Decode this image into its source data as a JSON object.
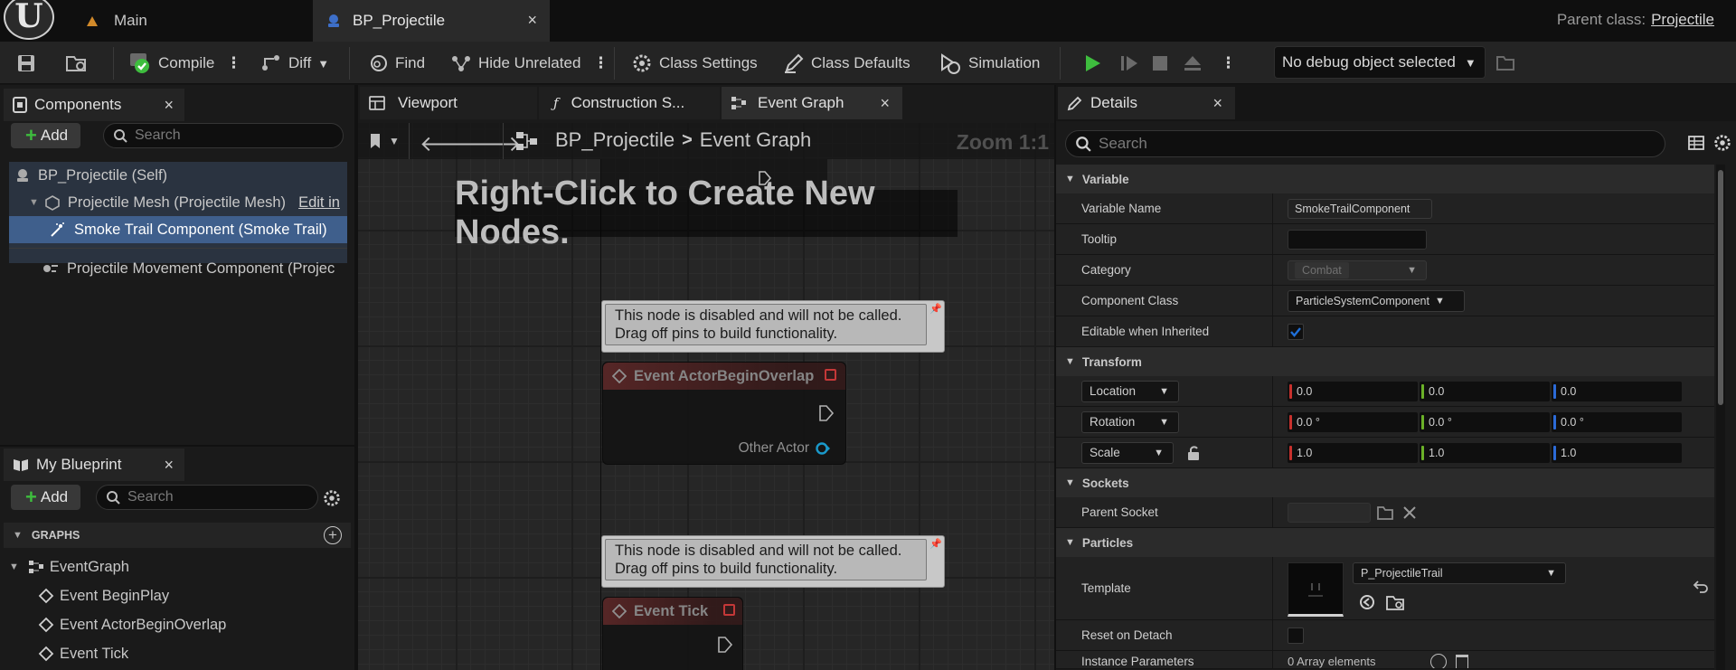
{
  "titlebar": {
    "logo": "U",
    "tabs": [
      {
        "label": "Main",
        "icon": "map-icon"
      },
      {
        "label": "BP_Projectile",
        "icon": "blueprint-icon",
        "close": "×"
      }
    ],
    "parent_class_label": "Parent class:",
    "parent_class_value": "Projectile"
  },
  "toolbar": {
    "compile": "Compile",
    "diff": "Diff",
    "find": "Find",
    "hide_unrelated": "Hide Unrelated",
    "class_settings": "Class Settings",
    "class_defaults": "Class Defaults",
    "simulation": "Simulation",
    "debug_object": "No debug object selected"
  },
  "components": {
    "tab_label": "Components",
    "close": "×",
    "add_label": "Add",
    "search_placeholder": "Search",
    "items": [
      {
        "label": "BP_Projectile (Self)"
      },
      {
        "label": "Projectile Mesh (Projectile Mesh)",
        "extra": "Edit in"
      },
      {
        "label": "Smoke Trail Component (Smoke Trail)"
      },
      {
        "label": "Projectile Movement Component (Projec"
      }
    ]
  },
  "my_blueprint": {
    "tab_label": "My Blueprint",
    "close": "×",
    "add_label": "Add",
    "search_placeholder": "Search",
    "graphs_header": "GRAPHS",
    "graph_name": "EventGraph",
    "events": [
      "Event BeginPlay",
      "Event ActorBeginOverlap",
      "Event Tick"
    ]
  },
  "graph_tabs": [
    {
      "label": "Viewport"
    },
    {
      "label": "Construction S..."
    },
    {
      "label": "Event Graph",
      "close": "×"
    }
  ],
  "graph": {
    "breadcrumb_root": "BP_Projectile",
    "breadcrumb_current": "Event Graph",
    "zoom": "Zoom 1:1",
    "hint": "Right-Click to Create New Nodes.",
    "comment_1": "This node is disabled and will not be called. Drag off pins to build functionality.",
    "comment_2": "This node is disabled and will not be called. Drag off pins to build functionality.",
    "node_1_title": "Event ActorBeginOverlap",
    "node_1_pin": "Other Actor",
    "node_2_title": "Event Tick"
  },
  "details": {
    "tab_label": "Details",
    "close": "×",
    "search_placeholder": "Search",
    "cat_variable": "Variable",
    "variable_name_label": "Variable Name",
    "variable_name_value": "SmokeTrailComponent",
    "tooltip_label": "Tooltip",
    "tooltip_value": "",
    "category_label": "Category",
    "category_value": "Combat",
    "component_class_label": "Component Class",
    "component_class_value": "ParticleSystemComponent",
    "editable_label": "Editable when Inherited",
    "editable_checked": true,
    "cat_transform": "Transform",
    "location_label": "Location",
    "location": [
      "0.0",
      "0.0",
      "0.0"
    ],
    "rotation_label": "Rotation",
    "rotation": [
      "0.0 °",
      "0.0 °",
      "0.0 °"
    ],
    "scale_label": "Scale",
    "scale": [
      "1.0",
      "1.0",
      "1.0"
    ],
    "cat_sockets": "Sockets",
    "parent_socket_label": "Parent Socket",
    "cat_particles": "Particles",
    "template_label": "Template",
    "template_value": "P_ProjectileTrail",
    "reset_on_detach_label": "Reset on Detach",
    "instance_params_label": "Instance Parameters",
    "instance_params_value": "0 Array elements"
  },
  "colors": {
    "accent_green": "#3ebd3e",
    "selection_blue": "#3a5a8a",
    "node_header_red": "#5a2626",
    "axis_x": "#c8312d",
    "axis_y": "#6bb128",
    "axis_z": "#2c6bd8",
    "check_blue": "#1f6fd8"
  }
}
